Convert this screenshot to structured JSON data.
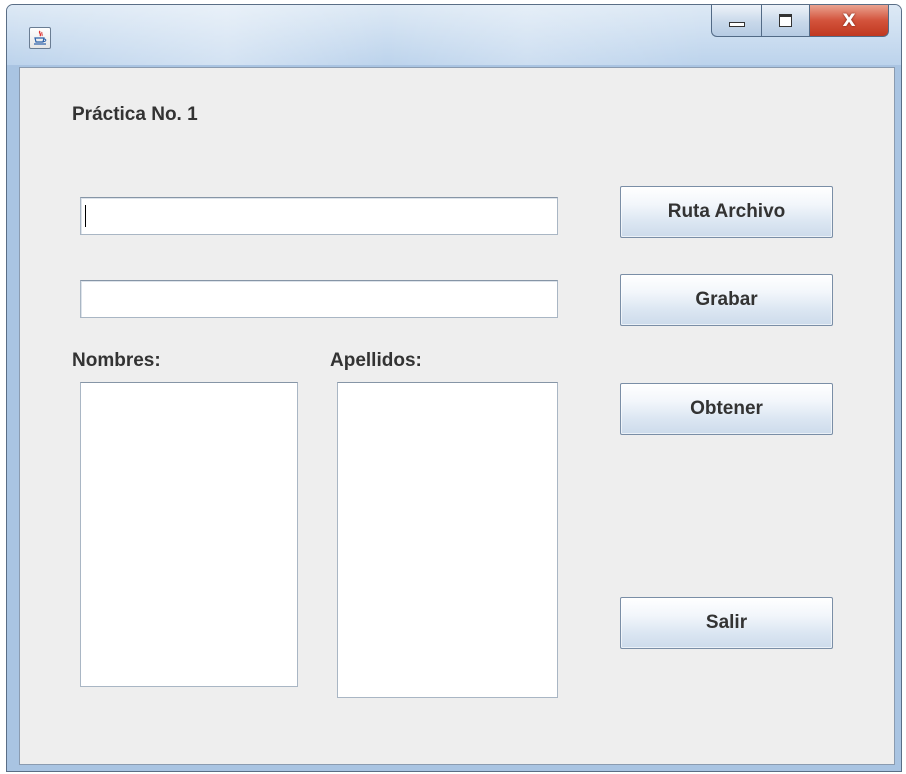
{
  "window": {
    "title": "",
    "icon": "java-cup-icon",
    "controls": {
      "minimize_icon": "minimize-icon",
      "maximize_icon": "maximize-icon",
      "close_label": "X"
    }
  },
  "form": {
    "heading": "Práctica No. 1",
    "path_field": {
      "value": ""
    },
    "record_field": {
      "value": ""
    },
    "nombres_label": "Nombres:",
    "apellidos_label": "Apellidos:",
    "nombres_list": {
      "value": ""
    },
    "apellidos_list": {
      "value": ""
    }
  },
  "buttons": {
    "ruta_archivo": "Ruta Archivo",
    "grabar": "Grabar",
    "obtener": "Obtener",
    "salir": "Salir"
  }
}
